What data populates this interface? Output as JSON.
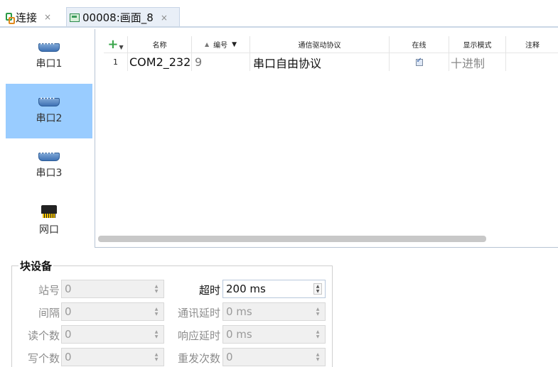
{
  "tabs": [
    {
      "label": "连接",
      "close": "×",
      "icon": "connection-icon"
    },
    {
      "label": "00008:画面_8",
      "close": "×",
      "icon": "screen-icon"
    }
  ],
  "sidebar": {
    "items": [
      {
        "label": "串口1",
        "icon": "serial-port-icon",
        "selected": false
      },
      {
        "label": "串口2",
        "icon": "serial-port-icon",
        "selected": true
      },
      {
        "label": "串口3",
        "icon": "serial-port-icon",
        "selected": false
      },
      {
        "label": "网口",
        "icon": "ethernet-port-icon",
        "selected": false
      }
    ]
  },
  "table": {
    "add_label": "+",
    "columns": [
      "名称",
      "编号",
      "通信驱动协议",
      "在线",
      "显示模式",
      "注释"
    ],
    "rows": [
      {
        "index": "1",
        "name": "COM2_232",
        "number": "9",
        "protocol": "串口自由协议",
        "online": true,
        "display_mode": "十进制",
        "comment": ""
      }
    ]
  },
  "block_device": {
    "title": "块设备",
    "fields": {
      "station": {
        "label": "站号",
        "value": "0"
      },
      "interval": {
        "label": "间隔",
        "value": "0"
      },
      "read_count": {
        "label": "读个数",
        "value": "0"
      },
      "write_count": {
        "label": "写个数",
        "value": "0"
      },
      "timeout": {
        "label": "超时",
        "value": "200 ms"
      },
      "comm_delay": {
        "label": "通讯延时",
        "value": "0 ms"
      },
      "response_delay": {
        "label": "响应延时",
        "value": "0 ms"
      },
      "retry_count": {
        "label": "重发次数",
        "value": "0"
      }
    }
  },
  "colors": {
    "selected_item": "#99ccff",
    "add_icon": "#3aa64b",
    "tab_active_bg": "#e9eff7"
  }
}
